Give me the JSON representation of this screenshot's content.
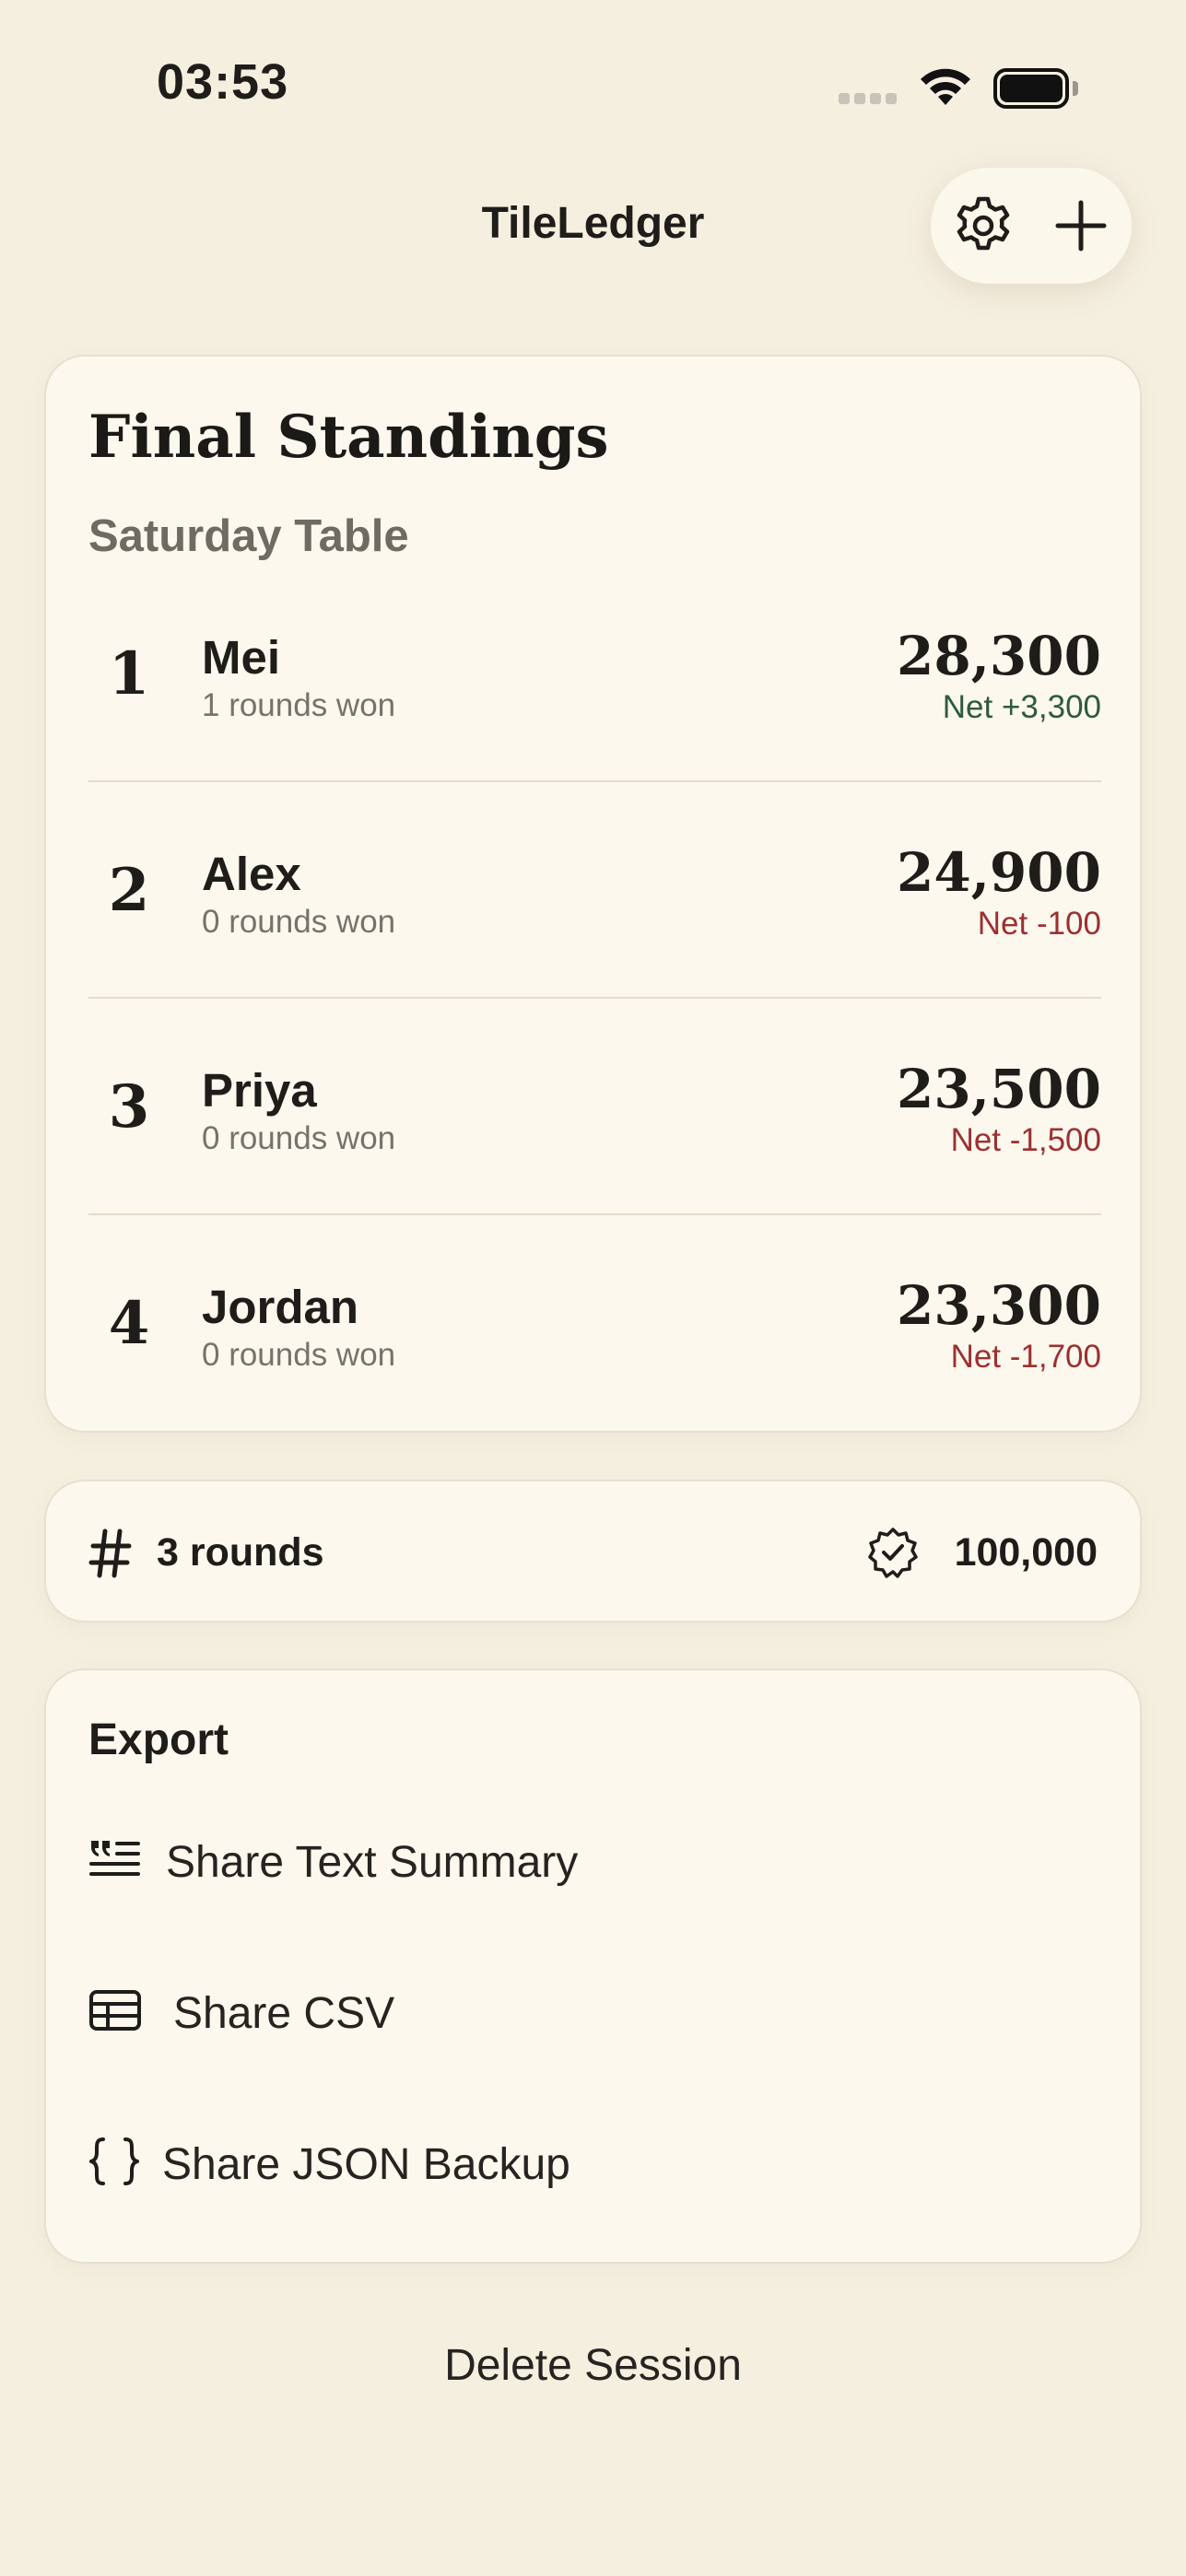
{
  "status_bar": {
    "time": "03:53"
  },
  "nav": {
    "title": "TileLedger"
  },
  "standings": {
    "title": "Final Standings",
    "subtitle": "Saturday Table",
    "players": [
      {
        "rank": "1",
        "name": "Mei",
        "rounds_won": "1 rounds won",
        "score": "28,300",
        "net": "Net +3,300",
        "net_positive": true
      },
      {
        "rank": "2",
        "name": "Alex",
        "rounds_won": "0 rounds won",
        "score": "24,900",
        "net": "Net -100",
        "net_positive": false
      },
      {
        "rank": "3",
        "name": "Priya",
        "rounds_won": "0 rounds won",
        "score": "23,500",
        "net": "Net -1,500",
        "net_positive": false
      },
      {
        "rank": "4",
        "name": "Jordan",
        "rounds_won": "0 rounds won",
        "score": "23,300",
        "net": "Net -1,700",
        "net_positive": false
      }
    ]
  },
  "summary": {
    "rounds": "3 rounds",
    "total": "100,000"
  },
  "export": {
    "title": "Export",
    "items": [
      {
        "label": "Share Text Summary",
        "icon": "text-summary-icon"
      },
      {
        "label": "Share CSV",
        "icon": "table-icon"
      },
      {
        "label": "Share JSON Backup",
        "icon": "braces-icon"
      }
    ]
  },
  "delete_label": "Delete Session",
  "colors": {
    "background": "#f5efe0",
    "card": "#fcf8ee",
    "net_positive": "#2e5a40",
    "net_negative": "#9c3030"
  }
}
